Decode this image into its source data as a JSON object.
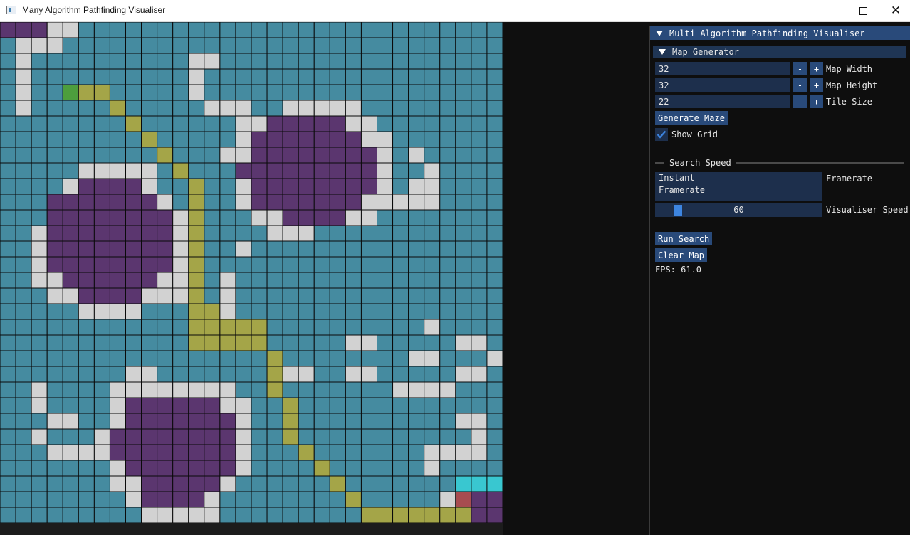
{
  "window": {
    "title": "Many Algorithm Pathfinding Visualiser",
    "controls": {
      "minimize": "minimize",
      "maximize": "maximize",
      "close": "close"
    }
  },
  "grid": {
    "rows": 32,
    "cols": 32,
    "legend": {
      "F": "floor",
      "W": "wall",
      "V": "visited",
      "P": "path",
      "S": "start",
      "E": "end",
      "C": "frontier",
      "B": "background"
    },
    "colors": {
      "F": "#458ba0",
      "W": "#d2d2d2",
      "V": "#5b366f",
      "P": "#a4a548",
      "S": "#4d9e3d",
      "E": "#a74c50",
      "C": "#39c7d0",
      "B": "#458ba0",
      "line": "#0a0a0a"
    },
    "cells": [
      "VVVWWFFFFFFFFFFFFFFFFFFFFFFFFFFF",
      "FWWWFFFFFFFFFFFFFFFFFFFFFFFFFFFF",
      "FWFFFFFFFFFFWWFFFFFFFFFFFFFFFFFF",
      "FWFFFFFFFFFFWFFFFFFFFFFFFFFFFFFF",
      "FWFFSPPFFFFFWFFFFFFFFFFFFFFFFFFF",
      "FWFFFFFPFFFFFWWWFFWWWWWFFFFFFFFF",
      "FFFFFFFFPFFFFFFWWVVVVVWWFFFFFFFF",
      "FFFFFFFFFPFFFFFWVVVVVVVWWFFFFFFF",
      "FFFFFFFFFFPFFFWWVVVVVVVVWFWFFFFF",
      "FFFFFWWWWWFPFFFVVVVVVVVVWFFWFFFF",
      "FFFFWVVVVWFFPFFWVVVVVVVVWFWWFFFF",
      "FFFVVVVVVVWFPFFWVVVVVVVWWWWWFFFF",
      "FFFVVVVVVVVWPFFFWWVVVVWWFFFFFFFF",
      "FFWVVVVVVVVWPFFFFWWWFFFFFFFFFFFF",
      "FFWVVVVVVVVWPFFWFFFFFFFFFFFFFFFF",
      "FFWVVVVVVVVWPFFFFFFFFFFFFFFFFFFF",
      "FFWWVVVVVVWWPFWFFFFFFFFFFFFFFFFF",
      "FFFWWVVVVWWWPFWFFFFFFFFFFFFFFFFF",
      "FFFFFWWWWFFFPPWFFFFFFFFFFFFFFFFF",
      "FFFFFFFFFFFFPPPPPFFFFFFFFFFWFFFF",
      "FFFFFFFFFFFFPPPPPFFFFFWWFFFFFWWF",
      "FFFFFFFFFFFFFFFFFPFFFFFFFFWWFFFW",
      "FFFFFFFFWWFFFFFFFPWWFFWWFFFFFWWF",
      "FFWFFFFWWWWWWWWFFPFFFFFFFWWWWFFF",
      "FFWFFFFWVVVVVVWWFFPFFFFFFFFFFFFF",
      "FFFWWFFWVVVVVVVWFFPFFFFFFFFFFWWF",
      "FFWFFFWVVVVVVVVWFFPFFFFFFFFFFFWF",
      "FFFWWWWVVVVVVVVWFFFPFFFFFFFWWWWF",
      "FFFFFFFWVVVVVVVWFFFFPFFFFFFWFFFF",
      "FFFFFFFWWVVVVVWFFFFFFPFFFFFFFCCC",
      "FFFFFFFFWVVVVWFFFFFFFFPFFFFFWEVV",
      "FFFFFFFFFWWWWWFFFFFFFFFPPPPPPPVV"
    ]
  },
  "panel": {
    "title": "Multi Algorithm Pathfinding Visualiser",
    "map_generator": {
      "header": "Map Generator",
      "fields": [
        {
          "value": "32",
          "minus": "-",
          "plus": "+",
          "label": "Map Width"
        },
        {
          "value": "32",
          "minus": "-",
          "plus": "+",
          "label": "Map Height"
        },
        {
          "value": "22",
          "minus": "-",
          "plus": "+",
          "label": "Tile Size"
        }
      ],
      "generate_button": "Generate Maze",
      "show_grid": {
        "label": "Show Grid",
        "checked": true
      }
    },
    "search_speed": {
      "separator": "Search Speed",
      "mode_options": [
        "Instant",
        "Framerate"
      ],
      "mode_label": "Framerate",
      "slider_value": 60,
      "slider_fraction": 0.11,
      "slider_label": "Visualiser Speed"
    },
    "run_button": "Run Search",
    "clear_button": "Clear Map",
    "fps": "FPS: 61.0"
  },
  "colors": {
    "accent": "#294a7a",
    "frame_bg": "#1d2f4c",
    "slider_grab": "#3d85e0",
    "checkmark": "#3d85e0",
    "panel_bg": "#0e0e0e"
  }
}
